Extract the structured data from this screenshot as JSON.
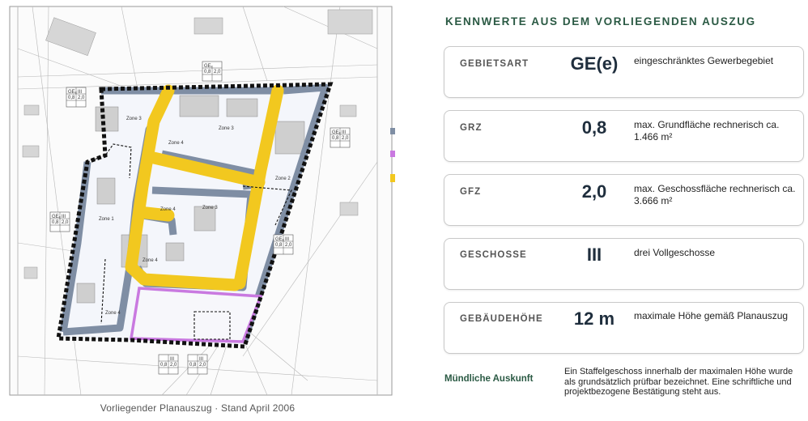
{
  "plan": {
    "caption": "Vorliegender Planauszug · Stand April 2006",
    "zones": [
      "Zone 1",
      "Zone 2",
      "Zone 3",
      "Zone 3",
      "Zone 3",
      "Zone 4",
      "Zone 4",
      "Zone 4",
      "Zone 4"
    ],
    "nutzungsschablone": {
      "gebiet": "GEₑ",
      "geschosse": "III",
      "grz": "0,8",
      "gfz": "2,0"
    },
    "colors": {
      "boundary": "#111111",
      "road": "#f2c81f",
      "buffer": "#7f8ea4",
      "purple": "#c979e0"
    }
  },
  "kennwerte": {
    "title": "KENNWERTE AUS DEM VORLIEGENDEN AUSZUG",
    "items": [
      {
        "label": "GEBIETSART",
        "value": "GE(e)",
        "desc": "eingeschränktes Gewerbegebiet"
      },
      {
        "label": "GRZ",
        "value": "0,8",
        "desc": "max. Grundfläche rechnerisch ca. 1.466 m²"
      },
      {
        "label": "GFZ",
        "value": "2,0",
        "desc": "max. Geschossfläche rechnerisch ca. 3.666 m²"
      },
      {
        "label": "GESCHOSSE",
        "value": "III",
        "desc": "drei Vollgeschosse"
      },
      {
        "label": "GEBÄUDEHÖHE",
        "value": "12 m",
        "desc": "maximale  Höhe gemäß Planauszug"
      }
    ]
  },
  "muendlich": {
    "label": "Mündliche  Auskunft",
    "text": "Ein Staffelgeschoss  innerhalb der maximalen  Höhe wurde als grundsätzlich  prüfbar bezeichnet.  Eine schriftliche und projektbezogene  Bestätigung  steht aus."
  }
}
